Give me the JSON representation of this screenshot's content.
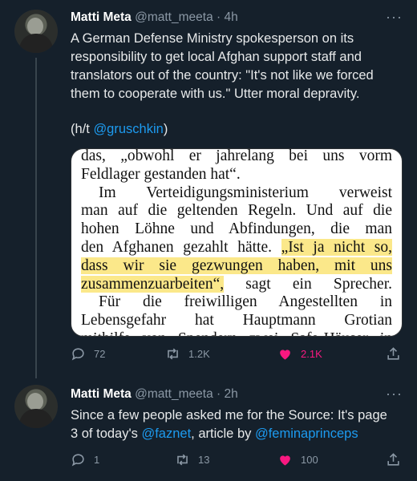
{
  "tweets": [
    {
      "name": "Matti Meta",
      "handle": "@matt_meeta",
      "time": "· 4h",
      "more": "···",
      "text_lines": [
        "A German Defense Ministry spokesperson on its",
        "responsibility to get local Afghan support staff and",
        "translators out of the country: \"It's not like we forced",
        "them to cooperate with us.\" Utter moral depravity."
      ],
      "hat_tip_prefix": "(h/t ",
      "hat_tip_link": "@gruschkin",
      "hat_tip_suffix": ")",
      "document_lines": [
        "das, „obwohl er jahrelang bei uns vorm",
        "Feldlager gestanden hat“.",
        "Im Verteidigungsministerium verweist",
        "man auf die geltenden Regeln. Und auf die",
        "hohen Löhne und Abfindungen, die man",
        "den Afghanen gezahlt hätte. ",
        "„Ist ja nicht so,",
        "dass wir sie gezwungen haben, mit uns",
        "zusammenzuarbeiten“,",
        " sagt ein Sprecher.",
        "Für die freiwilligen Angestellten in",
        "Lebensgefahr hat Hauptmann Grotian",
        "mithilfe von Spendern zwei Safe-Häuser in"
      ],
      "actions": {
        "replies": "72",
        "retweets": "1.2K",
        "likes": "2.1K"
      }
    },
    {
      "name": "Matti Meta",
      "handle": "@matt_meeta",
      "time": "· 2h",
      "more": "···",
      "line1": "Since a few people asked me for the Source: It's page",
      "line2_prefix": "3 of today's ",
      "line2_link1": "@faznet",
      "line2_mid": ", article by ",
      "line2_link2": "@feminaprinceps",
      "actions": {
        "replies": "1",
        "retweets": "13",
        "likes": "100"
      }
    }
  ],
  "colors": {
    "background": "#15202b",
    "link": "#1d9bf0",
    "like": "#f91880",
    "highlight": "#fbe88a"
  }
}
